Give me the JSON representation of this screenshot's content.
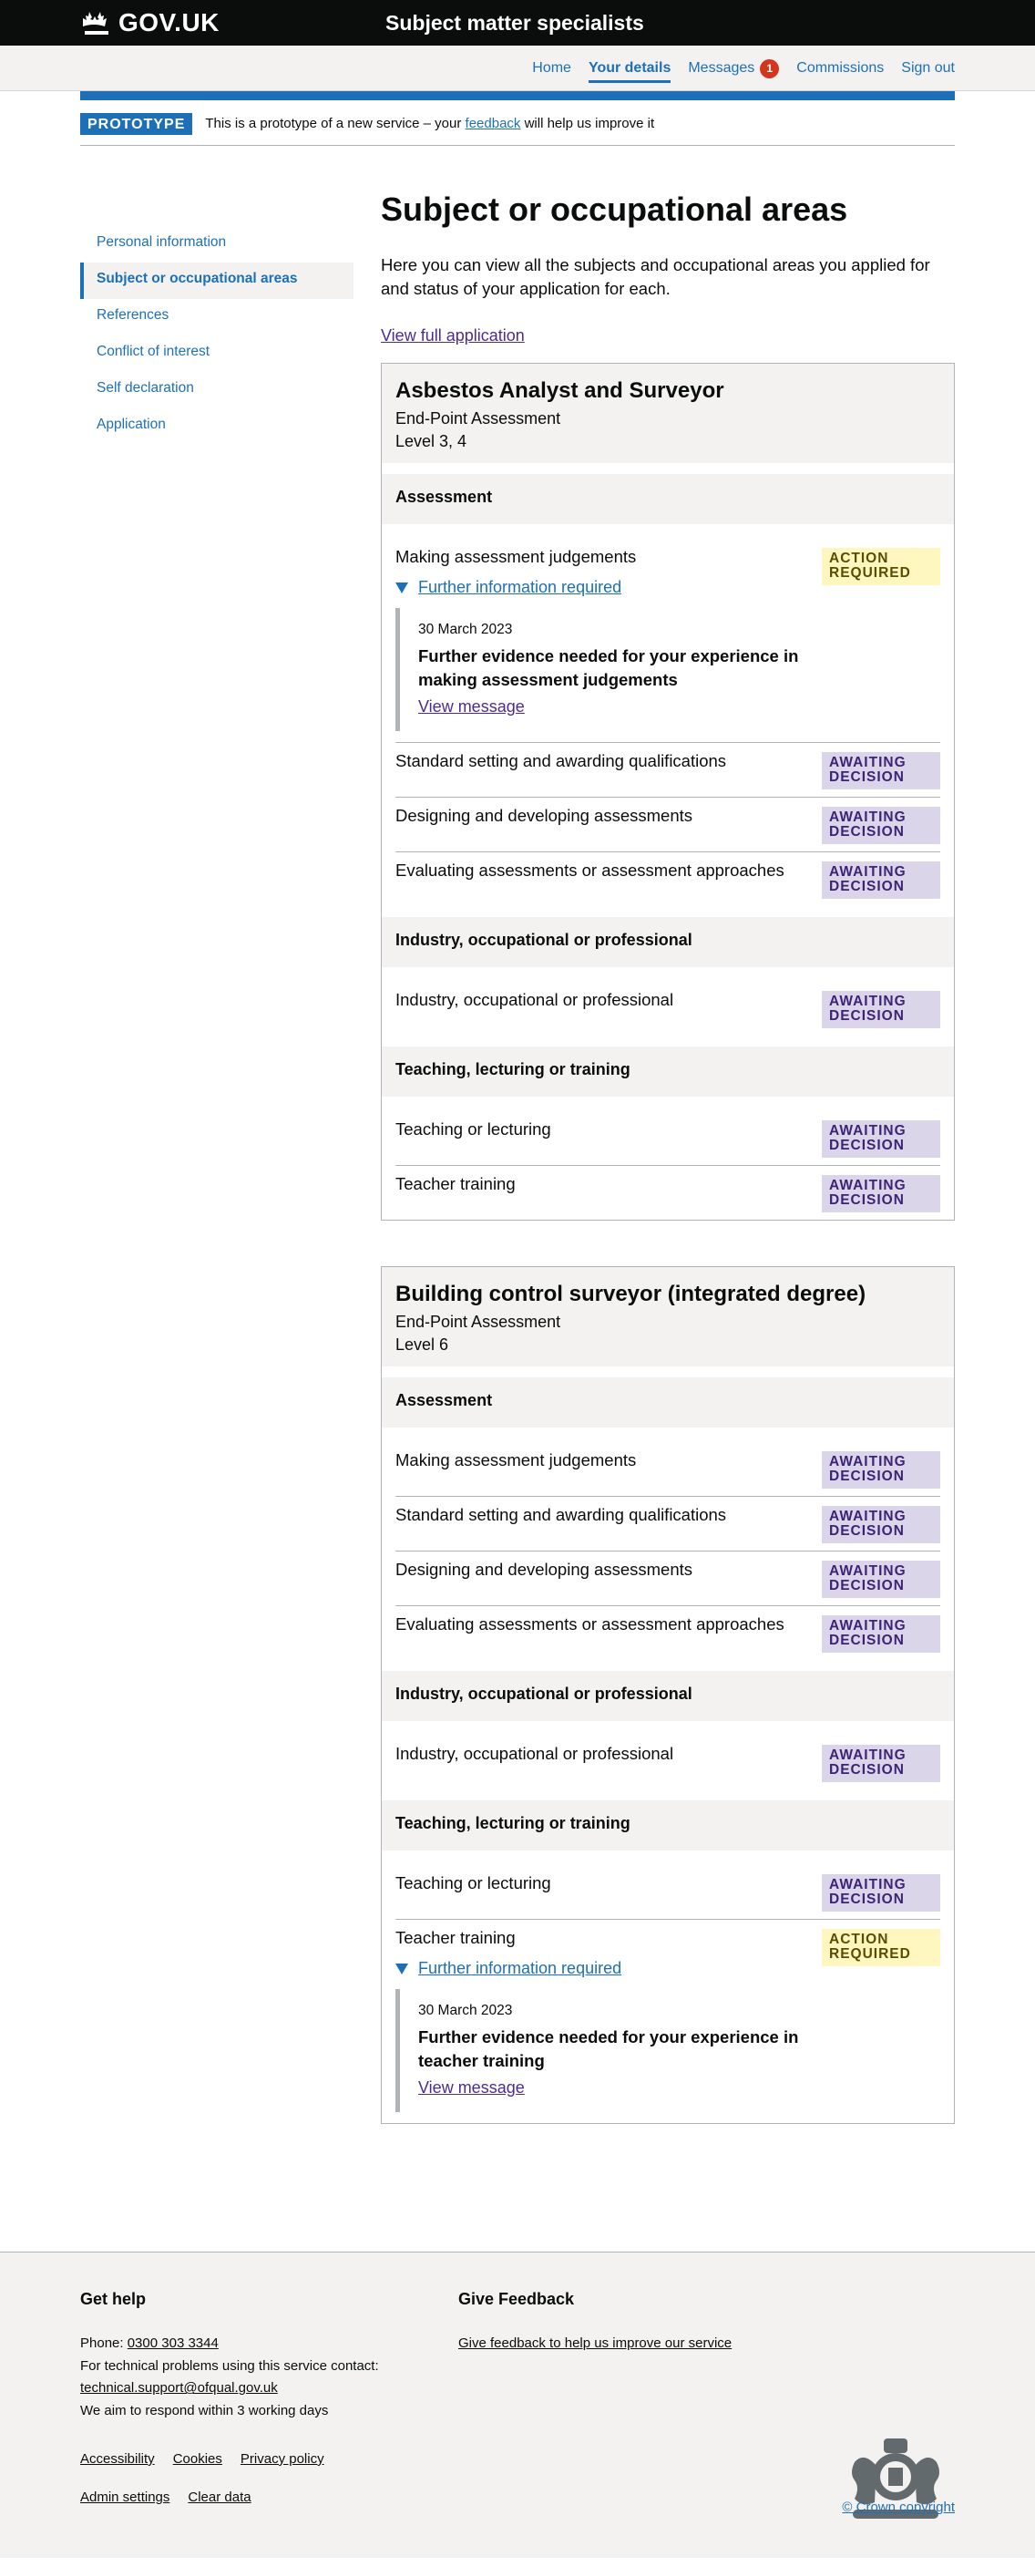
{
  "header": {
    "logo_text": "GOV.UK",
    "service_name": "Subject matter specialists",
    "nav": [
      {
        "label": "Home"
      },
      {
        "label": "Your details"
      },
      {
        "label": "Messages",
        "badge": "1"
      },
      {
        "label": "Commissions"
      },
      {
        "label": "Sign out"
      }
    ]
  },
  "phase_banner": {
    "tag": "PROTOTYPE",
    "text_before": "This is a prototype of a new service – your",
    "link": "feedback",
    "text_after": "will help us improve it"
  },
  "sidebar": {
    "items": [
      {
        "label": "Personal information"
      },
      {
        "label": "Subject or occupational areas"
      },
      {
        "label": "References"
      },
      {
        "label": "Conflict of interest"
      },
      {
        "label": "Self declaration"
      },
      {
        "label": "Application"
      }
    ]
  },
  "main": {
    "title": "Subject or occupational areas",
    "intro": "Here you can view all the subjects and occupational areas you applied for and status of your application for each.",
    "view_full_link": "View full application"
  },
  "cards": [
    {
      "title": "Asbestos Analyst and Surveyor",
      "type": "End-Point Assessment",
      "level": "Level 3, 4",
      "sections": [
        {
          "heading": "Assessment",
          "items": [
            {
              "label": "Making assessment judgements",
              "status": "ACTION REQUIRED",
              "details_summary": "Further information required",
              "msg_date": "30 March 2023",
              "msg_title": "Further evidence needed for your experience in making assessment judgements",
              "msg_link": "View message"
            },
            {
              "label": "Standard setting and awarding qualifications",
              "status": "AWAITING DECISION"
            },
            {
              "label": "Designing and developing assessments",
              "status": "AWAITING DECISION"
            },
            {
              "label": "Evaluating assessments or assessment approaches",
              "status": "AWAITING DECISION"
            }
          ]
        },
        {
          "heading": "Industry, occupational or professional",
          "items": [
            {
              "label": "Industry, occupational or professional",
              "status": "AWAITING DECISION"
            }
          ]
        },
        {
          "heading": "Teaching, lecturing or training",
          "items": [
            {
              "label": "Teaching or lecturing",
              "status": "AWAITING DECISION"
            },
            {
              "label": "Teacher training",
              "status": "AWAITING DECISION"
            }
          ]
        }
      ]
    },
    {
      "title": "Building control surveyor (integrated degree)",
      "type": "End-Point Assessment",
      "level": "Level 6",
      "sections": [
        {
          "heading": "Assessment",
          "items": [
            {
              "label": "Making assessment judgements",
              "status": "AWAITING DECISION"
            },
            {
              "label": "Standard setting and awarding qualifications",
              "status": "AWAITING DECISION"
            },
            {
              "label": "Designing and developing assessments",
              "status": "AWAITING DECISION"
            },
            {
              "label": "Evaluating assessments or assessment approaches",
              "status": "AWAITING DECISION"
            }
          ]
        },
        {
          "heading": "Industry, occupational or professional",
          "items": [
            {
              "label": "Industry, occupational or professional",
              "status": "AWAITING DECISION"
            }
          ]
        },
        {
          "heading": "Teaching, lecturing or training",
          "items": [
            {
              "label": "Teaching or lecturing",
              "status": "AWAITING DECISION"
            },
            {
              "label": "Teacher training",
              "status": "ACTION REQUIRED",
              "details_summary": "Further information required",
              "msg_date": "30 March 2023",
              "msg_title": "Further evidence needed for your experience in teacher training",
              "msg_link": "View message"
            }
          ]
        }
      ]
    }
  ],
  "footer": {
    "get_help": {
      "heading": "Get help",
      "phone_label": "Phone:",
      "phone": "0300 303 3344",
      "tech_text": "For technical problems using this service contact:",
      "email": "technical.support@ofqual.gov.uk",
      "respond": "We aim to respond within 3 working days"
    },
    "feedback": {
      "heading": "Give Feedback",
      "link": "Give feedback to help us improve our service"
    },
    "links_row1": [
      "Accessibility",
      "Cookies",
      "Privacy policy"
    ],
    "links_row2": [
      "Admin settings",
      "Clear data"
    ],
    "copyright": "© Crown copyright"
  },
  "colors": {
    "brand_blue": "#1d70b8",
    "header_black": "#0b0c0c",
    "awaiting_bg": "#dbd5e9",
    "awaiting_text": "#3d2375",
    "action_bg": "#fff7bf",
    "action_text": "#594d00"
  },
  "icons": {
    "logo": "crown-icon",
    "details_toggle": "triangle-down-icon",
    "footer_crest": "royal-coat-of-arms-icon"
  }
}
